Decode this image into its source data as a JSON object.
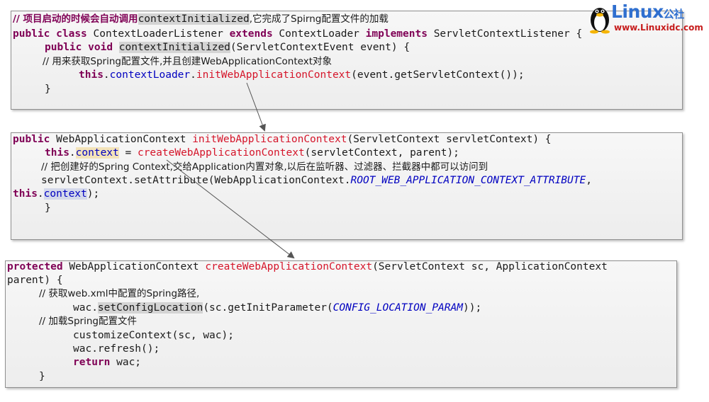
{
  "box1": {
    "l1": {
      "comment": "// 项目启动的时候会自动调用",
      "method": "contextInitialized",
      "tail": ",它完成了Spirng配置文件的加载"
    },
    "l2": {
      "kw1": "public",
      "kw2": "class",
      "t1": "ContextLoaderListener",
      "kw3": "extends",
      "t2": "ContextLoader",
      "kw4": "implements",
      "t3": "ServletContextListener {"
    },
    "l3": {
      "kw1": "public",
      "kw2": "void",
      "method": "contextInitialized",
      "tail": "(ServletContextEvent event) {"
    },
    "l4": {
      "comment": "// 用来获取Spring配置文件,并且创建WebApplicationContext对象"
    },
    "l5": {
      "kw": "this",
      "dot": ".",
      "field": "contextLoader",
      "dot2": ".",
      "method": "initWebApplicationContext",
      "tail": "(event.getServletContext());"
    },
    "l6": "}"
  },
  "box2": {
    "l1": {
      "kw": "public",
      "t1": "WebApplicationContext",
      "method": "initWebApplicationContext",
      "tail": "(ServletContext servletContext) {"
    },
    "l2": {
      "kw": "this",
      "dot": ".",
      "field": "context",
      "mid": " = ",
      "method": "createWebApplicationContext",
      "tail": "(servletContext, parent);"
    },
    "l3": {
      "comment": "// 把创建好的Spring Context,交给Application内置对象,以后在监听器、过滤器、拦截器中都可以访问到"
    },
    "l4": {
      "t1": "servletContext.setAttribute(WebApplicationContext.",
      "const": "ROOT_WEB_APPLICATION_CONTEXT_ATTRIBUTE",
      "tail": ","
    },
    "l5": {
      "kw": "this",
      "dot": ".",
      "field": "context",
      "tail": ");"
    },
    "l6": "}"
  },
  "box3": {
    "l1": {
      "kw": "protected",
      "t1": "WebApplicationContext",
      "method": "createWebApplicationContext",
      "tail": "(ServletContext sc, ApplicationContext"
    },
    "l2": "parent) {",
    "l3": {
      "comment": "// 获取web.xml中配置的Spring路径,"
    },
    "l4": {
      "t1": "wac.",
      "method": "setConfigLocation",
      "mid": "(sc.getInitParameter(",
      "const": "CONFIG_LOCATION_PARAM",
      "tail": "));"
    },
    "l5": {
      "comment": "// 加载Spring配置文件"
    },
    "l6": "customizeContext(sc, wac);",
    "l7": "wac.refresh();",
    "l8": {
      "kw": "return",
      "tail": " wac;"
    },
    "l9": "}"
  },
  "logo": {
    "brand": "Linux",
    "brand_suffix": "公社",
    "url": "www.Linuxidc.com"
  },
  "colors": {
    "keyword": "#7f0055",
    "method": "#d5152a",
    "field": "#0000c0",
    "brand": "#2f6fcf",
    "url": "#c61c1c"
  }
}
